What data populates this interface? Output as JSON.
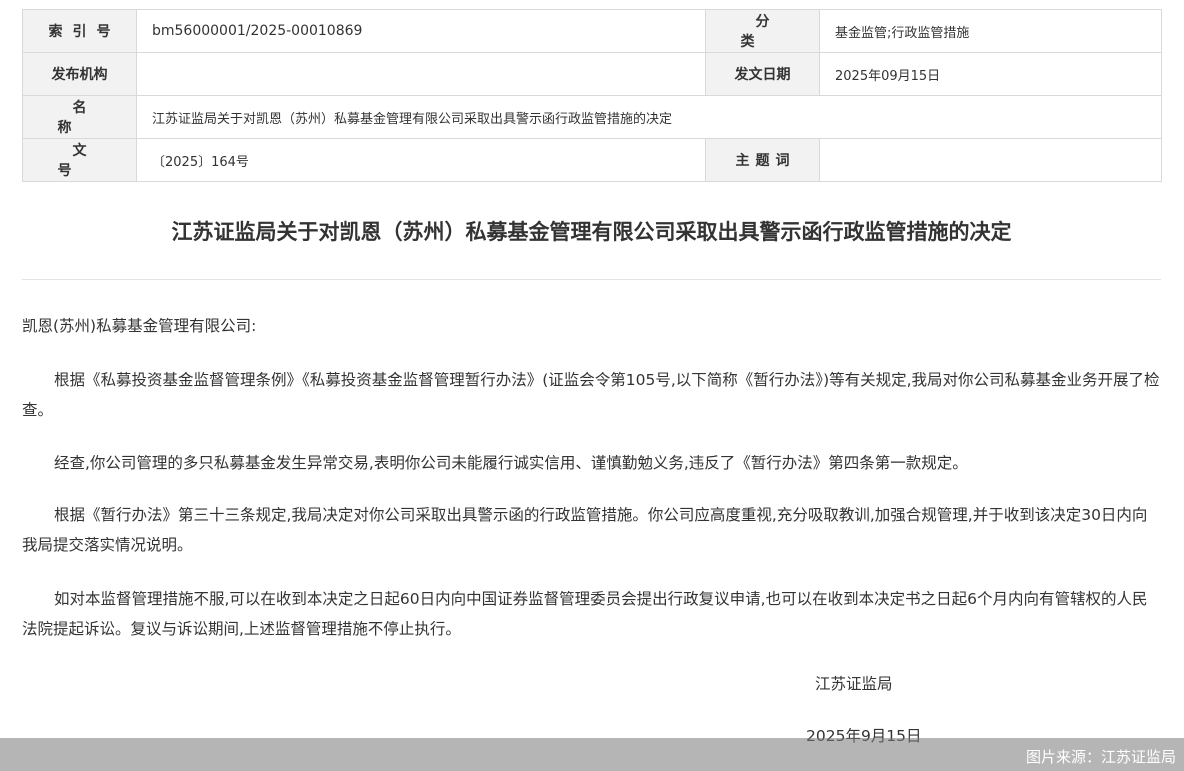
{
  "meta": {
    "index_label": "索引号",
    "index_value": "bm56000001/2025-00010869",
    "category_label": "分类",
    "category_value": "基金监管;行政监管措施",
    "issuer_label": "发布机构",
    "issuer_value": "",
    "date_label": "发文日期",
    "date_value": "2025年09月15日",
    "name_label": "名称",
    "name_value": "江苏证监局关于对凯恩（苏州）私募基金管理有限公司采取出具警示函行政监管措施的决定",
    "docno_label": "文号",
    "docno_value": "〔2025〕164号",
    "keywords_label": "主题词",
    "keywords_value": ""
  },
  "document": {
    "title": "江苏证监局关于对凯恩（苏州）私募基金管理有限公司采取出具警示函行政监管措施的决定",
    "addressee": "凯恩(苏州)私募基金管理有限公司:",
    "paragraphs": [
      "根据《私募投资基金监督管理条例》《私募投资基金监督管理暂行办法》(证监会令第105号,以下简称《暂行办法》)等有关规定,我局对你公司私募基金业务开展了检查。",
      "经查,你公司管理的多只私募基金发生异常交易,表明你公司未能履行诚实信用、谨慎勤勉义务,违反了《暂行办法》第四条第一款规定。",
      "根据《暂行办法》第三十三条规定,我局决定对你公司采取出具警示函的行政监管措施。你公司应高度重视,充分吸取教训,加强合规管理,并于收到该决定30日内向我局提交落实情况说明。",
      "如对本监督管理措施不服,可以在收到本决定之日起60日内向中国证券监督管理委员会提出行政复议申请,也可以在收到本决定书之日起6个月内向有管辖权的人民法院提起诉讼。复议与诉讼期间,上述监督管理措施不停止执行。"
    ],
    "signature": "江苏证监局",
    "sign_date": "2025年9月15日"
  },
  "footer": {
    "source": "图片来源：江苏证监局"
  }
}
